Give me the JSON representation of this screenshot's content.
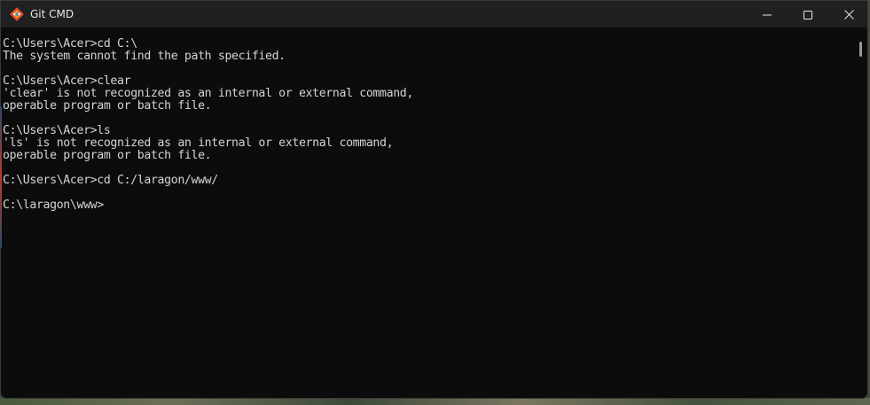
{
  "window": {
    "title": "Git CMD",
    "app_icon": "git-icon",
    "controls": {
      "minimize_icon": "minimize-icon",
      "maximize_icon": "maximize-icon",
      "close_icon": "close-icon"
    }
  },
  "terminal": {
    "lines": [
      "C:\\Users\\Acer>cd C:\\",
      "The system cannot find the path specified.",
      "",
      "C:\\Users\\Acer>clear",
      "'clear' is not recognized as an internal or external command,",
      "operable program or batch file.",
      "",
      "C:\\Users\\Acer>ls",
      "'ls' is not recognized as an internal or external command,",
      "operable program or batch file.",
      "",
      "C:\\Users\\Acer>cd C:/laragon/www/",
      "",
      "C:\\laragon\\www>"
    ],
    "colors": {
      "background": "#0c0c0c",
      "foreground": "#d4d4d4"
    }
  }
}
